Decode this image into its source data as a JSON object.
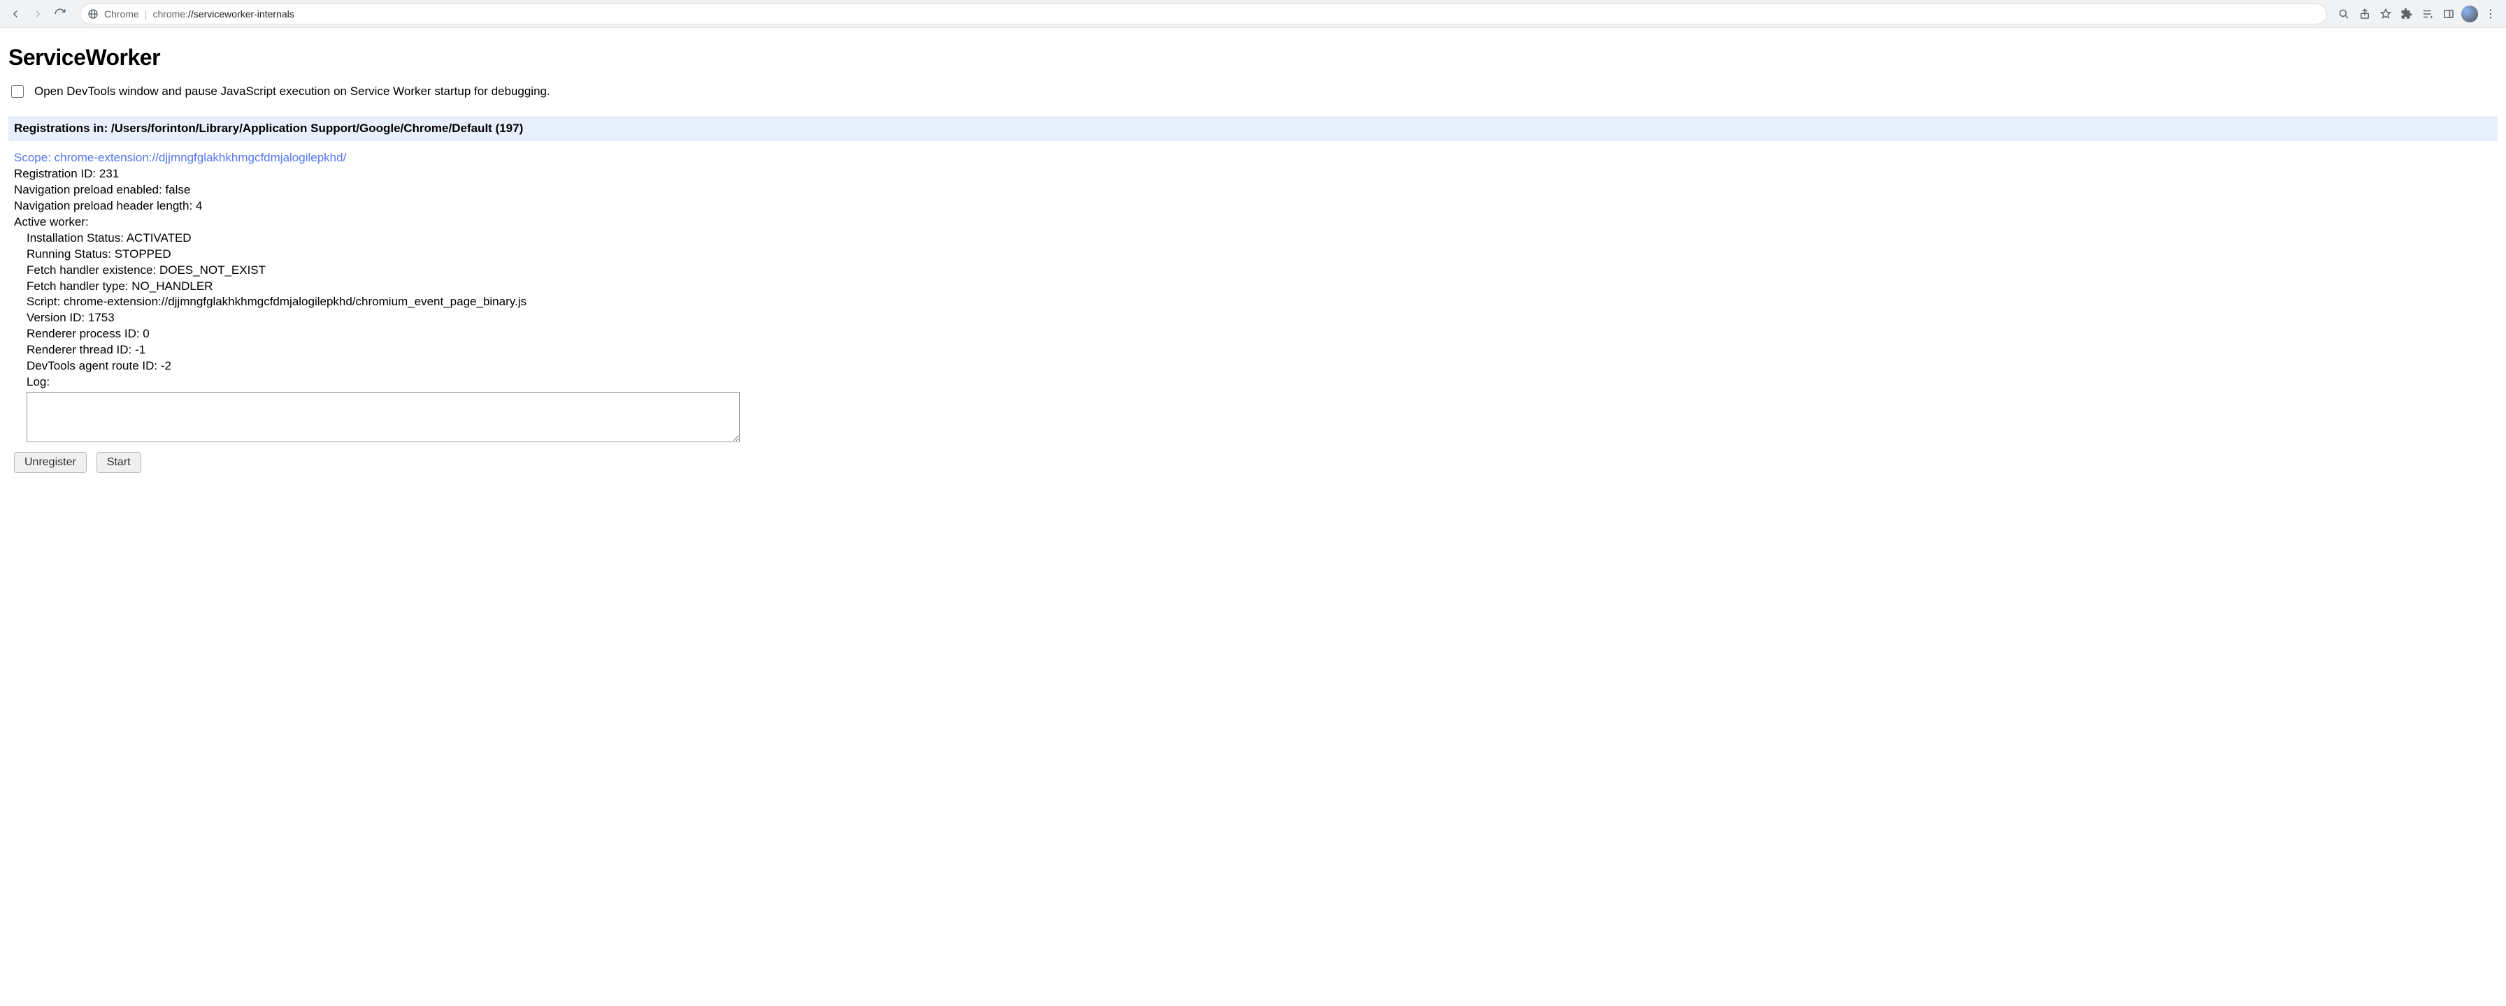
{
  "toolbar": {
    "site_label": "Chrome",
    "url_scheme": "chrome:",
    "url_path": "//serviceworker-internals"
  },
  "page": {
    "title": "ServiceWorker",
    "debug_checkbox_label": "Open DevTools window and pause JavaScript execution on Service Worker startup for debugging."
  },
  "section": {
    "header": "Registrations in: /Users/forinton/Library/Application Support/Google/Chrome/Default (197)"
  },
  "registration": {
    "scope_label": "Scope: chrome-extension://djjmngfglakhkhmgcfdmjalogilepkhd/",
    "reg_id": "Registration ID: 231",
    "nav_preload_enabled": "Navigation preload enabled: false",
    "nav_preload_header_len": "Navigation preload header length: 4",
    "active_worker_label": "Active worker:",
    "install_status": "Installation Status: ACTIVATED",
    "running_status": "Running Status: STOPPED",
    "fetch_handler_existence": "Fetch handler existence: DOES_NOT_EXIST",
    "fetch_handler_type": "Fetch handler type: NO_HANDLER",
    "script": "Script: chrome-extension://djjmngfglakhkhmgcfdmjalogilepkhd/chromium_event_page_binary.js",
    "version_id": "Version ID: 1753",
    "renderer_pid": "Renderer process ID: 0",
    "renderer_tid": "Renderer thread ID: -1",
    "devtools_route_id": "DevTools agent route ID: -2",
    "log_label": "Log:",
    "log_value": ""
  },
  "buttons": {
    "unregister": "Unregister",
    "start": "Start"
  }
}
